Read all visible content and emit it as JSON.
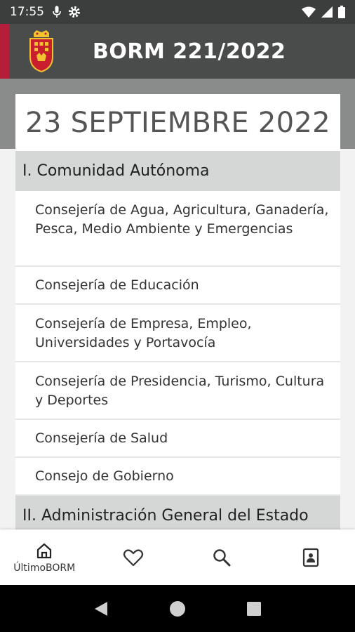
{
  "status_bar": {
    "time": "17:55"
  },
  "app_bar": {
    "title": "BORM 221/2022",
    "accent_color": "#b51e3a"
  },
  "date_card": {
    "text": "23 SEPTIEMBRE 2022"
  },
  "sections": [
    {
      "title": "I. Comunidad Autónoma",
      "items": [
        "Consejería de Agua, Agricultura, Ganadería, Pesca, Medio Ambiente y Emergencias",
        "Consejería de Educación",
        "Consejería de Empresa, Empleo, Universidades y Portavocía",
        "Consejería de Presidencia, Turismo, Cultura y Deportes",
        "Consejería de Salud",
        "Consejo de Gobierno"
      ]
    },
    {
      "title": "II. Administración General del Estado"
    }
  ],
  "bottom_nav": {
    "items": [
      {
        "label": "ÚltimoBORM",
        "icon": "home-icon"
      },
      {
        "icon": "heart-icon"
      },
      {
        "icon": "search-icon"
      },
      {
        "icon": "document-person-icon"
      }
    ]
  }
}
